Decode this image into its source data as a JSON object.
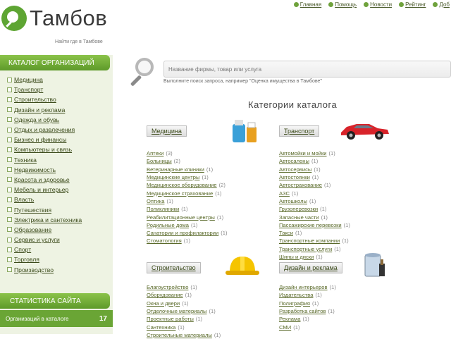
{
  "top_nav": [
    {
      "label": "Главная"
    },
    {
      "label": "Помощь"
    },
    {
      "label": "Новости"
    },
    {
      "label": "Рейтинг"
    },
    {
      "label": "Доб"
    }
  ],
  "logo": {
    "title": "Тамбов",
    "subtitle": "Найти где в Тамбове"
  },
  "sidebar": {
    "heading": "КАТАЛОГ ОРГАНИЗАЦИЙ",
    "items": [
      "Медицина",
      "Транспорт",
      "Строительство",
      "Дизайн и реклама",
      "Одежда и обувь",
      "Отдых и развлечения",
      "Бизнес и финансы",
      "Компьютеры и связь",
      "Техника",
      "Недвижимость",
      "Красота и здоровье",
      "Мебель и интерьер",
      "Власть",
      "Путешествия",
      "Электрика и сантехника",
      "Образование",
      "Сервис и услуги",
      "Спорт",
      "Торговля",
      "Производство"
    ],
    "stats_heading": "СТАТИСТИКА САЙТА",
    "stats_label": "Организаций в каталоге",
    "stats_value": "17"
  },
  "search": {
    "placeholder": "Название фирмы, товар или услуга",
    "hint": "Выполните поиск запроса, например \"Оценка имущества в Тамбове\""
  },
  "catalog_title": "Категории каталога",
  "blocks": [
    {
      "heading": "Медицина",
      "items": [
        {
          "name": "Аптеки",
          "count": "(3)"
        },
        {
          "name": "Больницы",
          "count": "(2)"
        },
        {
          "name": "Ветеринарные клиники",
          "count": "(1)"
        },
        {
          "name": "Медицинские центры",
          "count": "(1)"
        },
        {
          "name": "Медицинское оборудование",
          "count": "(2)"
        },
        {
          "name": "Медицинское страхование",
          "count": "(1)"
        },
        {
          "name": "Оптика",
          "count": "(1)"
        },
        {
          "name": "Поликлиники",
          "count": "(1)"
        },
        {
          "name": "Реабилитационные центры",
          "count": "(1)"
        },
        {
          "name": "Родильные дома",
          "count": "(1)"
        },
        {
          "name": "Санатории и профилактории",
          "count": "(1)"
        },
        {
          "name": "Стоматология",
          "count": "(1)"
        }
      ]
    },
    {
      "heading": "Транспорт",
      "items": [
        {
          "name": "Автомойки и мойки",
          "count": "(1)"
        },
        {
          "name": "Автосалоны",
          "count": "(1)"
        },
        {
          "name": "Автосервисы",
          "count": "(1)"
        },
        {
          "name": "Автостоянки",
          "count": "(1)"
        },
        {
          "name": "Автострахование",
          "count": "(1)"
        },
        {
          "name": "АЗС",
          "count": "(1)"
        },
        {
          "name": "Автошколы",
          "count": "(1)"
        },
        {
          "name": "Грузоперевозки",
          "count": "(1)"
        },
        {
          "name": "Запасные части",
          "count": "(1)"
        },
        {
          "name": "Пассажирские перевозки",
          "count": "(1)"
        },
        {
          "name": "Такси",
          "count": "(1)"
        },
        {
          "name": "Транспортные компании",
          "count": "(1)"
        },
        {
          "name": "Транспортные услуги",
          "count": "(1)"
        },
        {
          "name": "Шины и диски",
          "count": "(1)"
        }
      ]
    },
    {
      "heading": "Строительство",
      "items": [
        {
          "name": "Благоустройство",
          "count": "(1)"
        },
        {
          "name": "Оборудование",
          "count": "(1)"
        },
        {
          "name": "Окна и двери",
          "count": "(1)"
        },
        {
          "name": "Отделочные материалы",
          "count": "(1)"
        },
        {
          "name": "Проектные работы",
          "count": "(1)"
        },
        {
          "name": "Сантехника",
          "count": "(1)"
        },
        {
          "name": "Строительные материалы",
          "count": "(1)"
        }
      ]
    },
    {
      "heading": "Дизайн и реклама",
      "items": [
        {
          "name": "Дизайн интерьеров",
          "count": "(1)"
        },
        {
          "name": "Издательства",
          "count": "(1)"
        },
        {
          "name": "Полиграфия",
          "count": "(1)"
        },
        {
          "name": "Разработка сайтов",
          "count": "(1)"
        },
        {
          "name": "Реклама",
          "count": "(1)"
        },
        {
          "name": "СМИ",
          "count": "(1)"
        }
      ]
    }
  ]
}
